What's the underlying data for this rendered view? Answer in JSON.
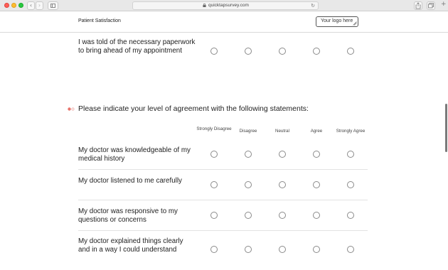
{
  "browser": {
    "url": "quicktapsurvey.com",
    "icons": [
      "back-arrow-icon",
      "forward-arrow-icon",
      "sidebar-icon",
      "lock-icon",
      "reload-icon",
      "share-icon",
      "tabs-icon",
      "plus-icon"
    ]
  },
  "header": {
    "title": "Patient Satisfaction",
    "logo_label": "Your logo here"
  },
  "previous_question": {
    "text": "I was told of the necessary paperwork to bring ahead of my appointment"
  },
  "matrix": {
    "required_icon": "required-indicator-icon",
    "title": "Please indicate your level of agreement with the following statements:",
    "columns": [
      "Strongly Disagree",
      "Disagree",
      "Neutral",
      "Agree",
      "Strongly Agree"
    ],
    "rows": [
      {
        "text": "My doctor was knowledgeable of my medical history"
      },
      {
        "text": "My doctor listened to me carefully"
      },
      {
        "text": "My doctor was responsive to my questions or concerns"
      },
      {
        "text": "My doctor explained things clearly and in a way I could understand"
      }
    ]
  },
  "colors": {
    "required_accent": "#e8736b",
    "radio_border": "#8a8a8a",
    "separator": "#e2e2e2"
  }
}
